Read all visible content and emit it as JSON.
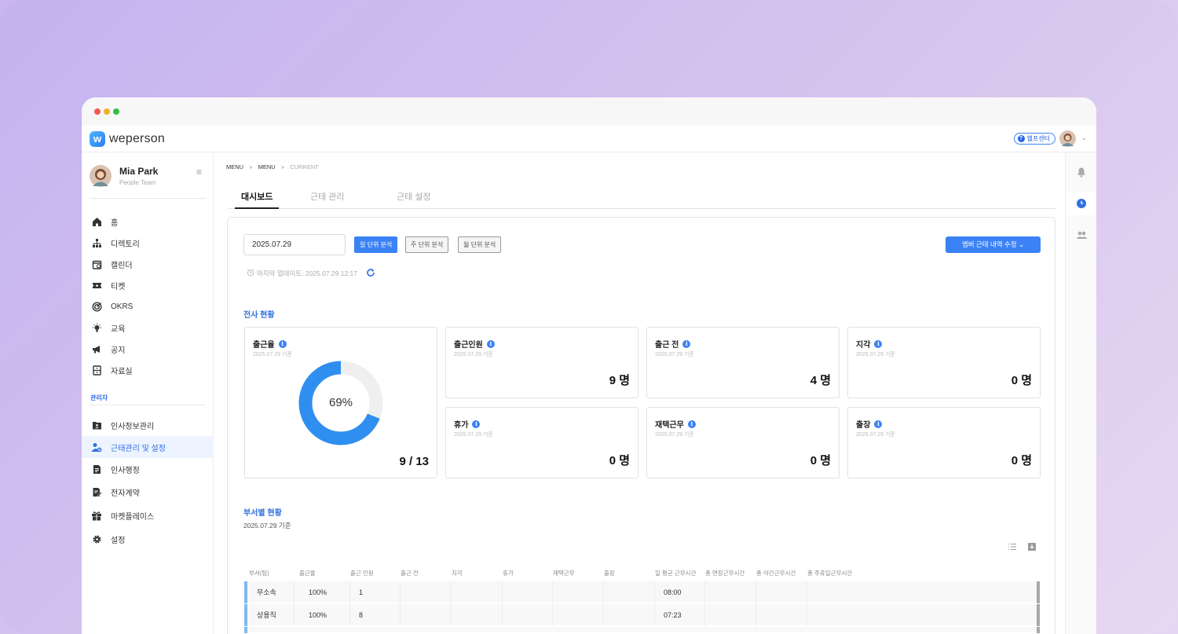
{
  "app": {
    "logo_text": "weperson",
    "logo_letter": "w"
  },
  "topbar": {
    "help_label": "헬프센터"
  },
  "profile": {
    "name": "Mia Park",
    "team": "People Team"
  },
  "sidebar": {
    "items": [
      {
        "label": "홈",
        "icon": "home-icon"
      },
      {
        "label": "디렉토리",
        "icon": "org-chart-icon"
      },
      {
        "label": "캘린더",
        "icon": "calendar-icon"
      },
      {
        "label": "티켓",
        "icon": "ticket-icon"
      },
      {
        "label": "OKRS",
        "icon": "target-icon"
      },
      {
        "label": "교육",
        "icon": "lightbulb-icon"
      },
      {
        "label": "공지",
        "icon": "megaphone-icon"
      },
      {
        "label": "자료실",
        "icon": "archive-icon"
      }
    ],
    "admin_label": "관리자",
    "admin_items": [
      {
        "label": "인사정보관리",
        "icon": "id-folder-icon"
      },
      {
        "label": "근태관리 및 설정",
        "icon": "user-settings-icon",
        "active": true
      },
      {
        "label": "인사행정",
        "icon": "document-icon"
      },
      {
        "label": "전자계약",
        "icon": "contract-icon"
      },
      {
        "label": "마켓플레이스",
        "icon": "gift-icon"
      },
      {
        "label": "설정",
        "icon": "gear-icon"
      }
    ]
  },
  "breadcrumb": {
    "first": "MENU",
    "second": "MENU",
    "current": "CURRENT"
  },
  "tabs": [
    {
      "label": "대시보드",
      "active": true
    },
    {
      "label": "근태 관리"
    },
    {
      "label": "근태 설정"
    }
  ],
  "controls": {
    "date": "2025.07.29",
    "day_btn": "일 단위 분석",
    "week_btn": "주 단위 분석",
    "month_btn": "월 단위 분석",
    "edit_btn": "멤버 근태 내역 수정",
    "last_update": "마지막 업데이트: 2025.07.29 12:17"
  },
  "company": {
    "title": "전사 현황",
    "rate_card": {
      "title": "출근율",
      "sub": "2025.07.29 기준",
      "percent": 69,
      "percent_label": "69%",
      "value": "9 / 13"
    },
    "cards": [
      {
        "title": "출근인원",
        "sub": "2025.07.29 기준",
        "value": "9 명"
      },
      {
        "title": "출근 전",
        "sub": "2025.07.29 기준",
        "value": "4 명"
      },
      {
        "title": "지각",
        "sub": "2025.07.29 기준",
        "value": "0 명"
      },
      {
        "title": "휴가",
        "sub": "2025.07.29 기준",
        "value": "0 명"
      },
      {
        "title": "재택근무",
        "sub": "2025.07.29 기준",
        "value": "0 명"
      },
      {
        "title": "출장",
        "sub": "2025.07.29 기준",
        "value": "0 명"
      }
    ]
  },
  "dept": {
    "title": "부서별 현황",
    "date": "2025.07.29 기준",
    "columns": [
      "부서(팀)",
      "출근율",
      "출근 인원",
      "출근 전",
      "지각",
      "휴가",
      "재택근무",
      "출장",
      "일 평균 근무시간",
      "총 연장근무시간",
      "총 야간근무시간",
      "총 주휴일근무시간"
    ],
    "rows": [
      {
        "dept": "무소속",
        "rate": "100%",
        "count": "1",
        "avg": "08:00"
      },
      {
        "dept": "상용직",
        "rate": "100%",
        "count": "8",
        "avg": "07:23"
      }
    ]
  },
  "colors": {
    "accent": "#3b82f6",
    "donut_track": "#efefef"
  }
}
